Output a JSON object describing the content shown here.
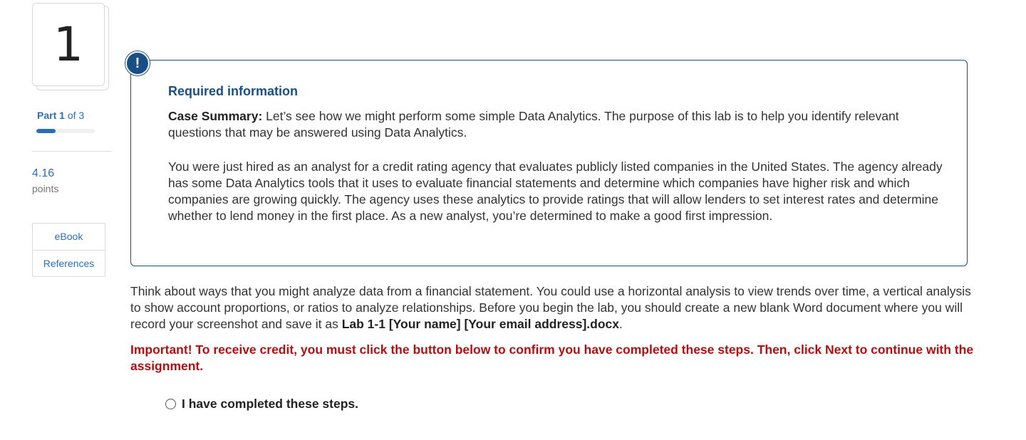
{
  "question": {
    "number": "1"
  },
  "progress": {
    "part_label": "Part",
    "part_current": "1",
    "part_of": "of 3",
    "fraction": 0.33
  },
  "points": {
    "value": "4.16",
    "label": "points"
  },
  "resources": {
    "ebook": "eBook",
    "references": "References"
  },
  "info": {
    "badge": "!",
    "title": "Required information",
    "case_label": "Case Summary:",
    "case_text": " Let’s see how we might perform some simple Data Analytics. The purpose of this lab is to help you identify relevant questions that may be answered using Data Analytics.",
    "paragraph2": "You were just hired as an analyst for a credit rating agency that evaluates publicly listed companies in the United States. The agency already has some Data Analytics tools that it uses to evaluate financial statements and determine which companies have higher risk and which companies are growing quickly. The agency uses these analytics to provide ratings that will allow lenders to set interest rates and determine whether to lend money in the first place. As a new analyst, you’re determined to make a good first impression."
  },
  "body": {
    "text_before": "Think about ways that you might analyze data from a financial statement. You could use a horizontal analysis to view trends over time, a vertical analysis to show account proportions, or ratios to analyze relationships. Before you begin the lab, you should create a new blank Word document where you will record your screenshot and save it as ",
    "filename": "Lab 1-1 [Your name] [Your email address].docx",
    "text_after": ".",
    "important": "Important! To receive credit, you must click the button below to confirm you have completed these steps. Then, click Next to continue with the assignment."
  },
  "confirm": {
    "label": "I have completed these steps."
  },
  "colors": {
    "accent": "#2f6eb5",
    "info_border": "#1a4f85",
    "important": "#b30f0f"
  }
}
